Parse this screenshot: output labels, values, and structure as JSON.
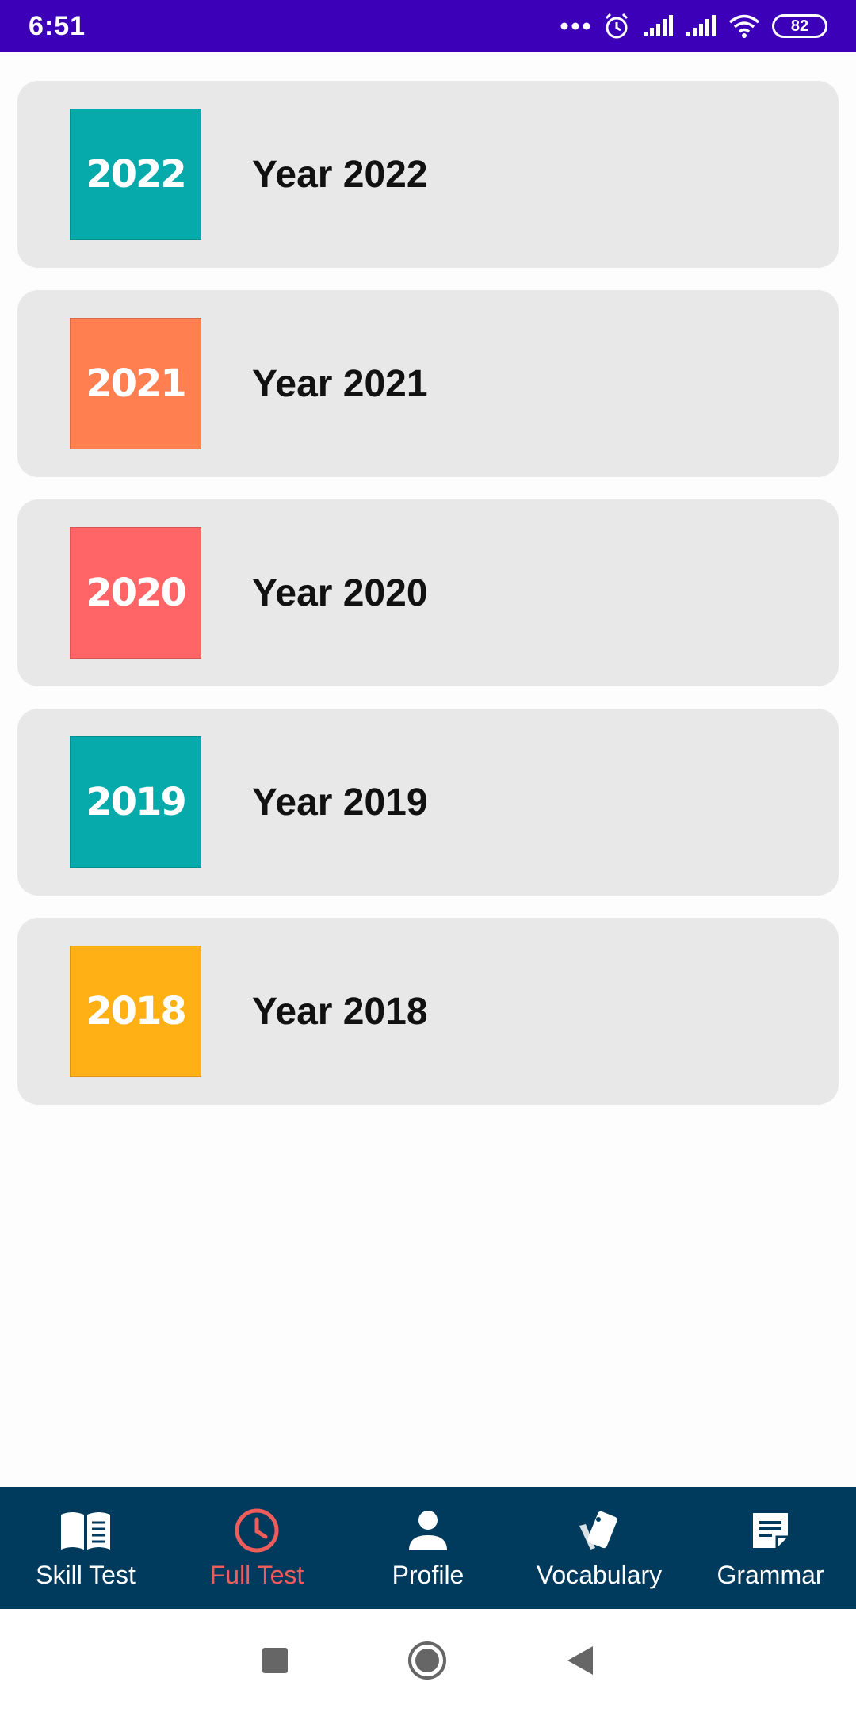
{
  "status_bar": {
    "time": "6:51",
    "battery": "82",
    "icons": [
      "more-dots-icon",
      "alarm-icon",
      "signal-icon",
      "signal-icon",
      "wifi-icon",
      "battery-icon"
    ]
  },
  "years": [
    {
      "thumb_text": "2022",
      "label": "Year 2022",
      "color": "#07aaaa"
    },
    {
      "thumb_text": "2021",
      "label": "Year 2021",
      "color": "#ff7f50"
    },
    {
      "thumb_text": "2020",
      "label": "Year 2020",
      "color": "#ff6466"
    },
    {
      "thumb_text": "2019",
      "label": "Year 2019",
      "color": "#07aaaa"
    },
    {
      "thumb_text": "2018",
      "label": "Year 2018",
      "color": "#ffb015"
    }
  ],
  "bottom_nav": {
    "items": [
      {
        "label": "Skill Test",
        "icon": "book-icon"
      },
      {
        "label": "Full Test",
        "icon": "clock-icon",
        "active": true
      },
      {
        "label": "Profile",
        "icon": "person-icon"
      },
      {
        "label": "Vocabulary",
        "icon": "cards-icon"
      },
      {
        "label": "Grammar",
        "icon": "note-icon"
      }
    ],
    "background": "#003a5c",
    "active_color": "#ef5c5c"
  },
  "colors": {
    "status_bar": "#3b00b8",
    "card_bg": "#e8e8e8"
  }
}
